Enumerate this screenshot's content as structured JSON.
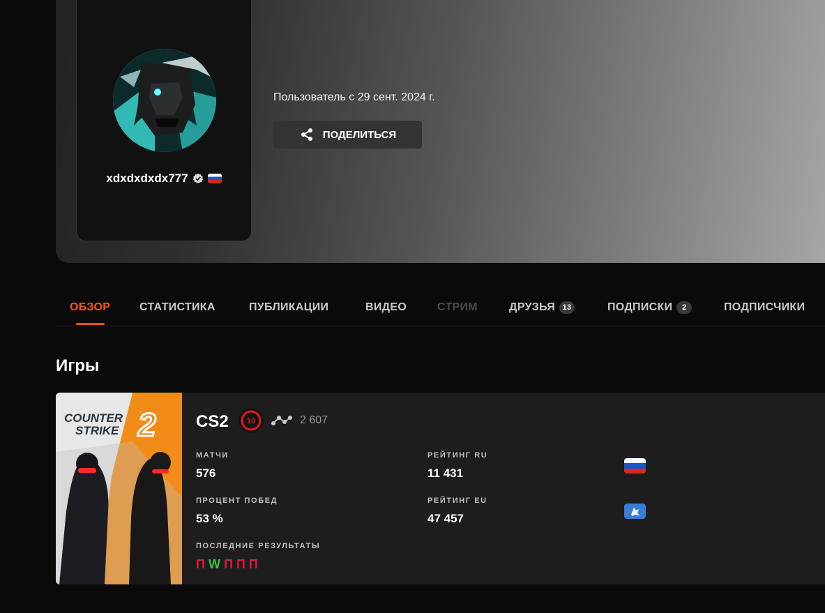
{
  "profile": {
    "username": "xdxdxdxdx777",
    "member_since": "Пользователь с 29 сент. 2024 г.",
    "share_label": "ПОДЕЛИТЬСЯ"
  },
  "tabs": [
    {
      "label": "ОБЗОР",
      "state": "active"
    },
    {
      "label": "СТАТИСТИКА"
    },
    {
      "label": "ПУБЛИКАЦИИ"
    },
    {
      "label": "ВИДЕО"
    },
    {
      "label": "СТРИМ",
      "state": "disabled"
    },
    {
      "label": "ДРУЗЬЯ",
      "badge": "13"
    },
    {
      "label": "ПОДПИСКИ",
      "badge": "2"
    },
    {
      "label": "ПОДПИСЧИКИ"
    }
  ],
  "games_title": "Игры",
  "game": {
    "name": "CS2",
    "cover_line1": "COUNTER",
    "cover_line2": "STRIKE",
    "cover_num": "2",
    "level": "10",
    "elo": "2 607",
    "matches_label": "МАТЧИ",
    "matches": "576",
    "winrate_label": "ПРОЦЕНТ ПОБЕД",
    "winrate": "53 %",
    "recent_label": "ПОСЛЕДНИЕ РЕЗУЛЬТАТЫ",
    "recent": [
      "П",
      "W",
      "П",
      "П",
      "П"
    ],
    "rating_ru_label": "РЕЙТИНГ RU",
    "rating_ru": "11 431",
    "rating_eu_label": "РЕЙТИНГ EU",
    "rating_eu": "47 457"
  },
  "colors": {
    "accent": "#ff5500",
    "win": "#3cc444",
    "loss": "#e1173a",
    "level": "#e01a1a"
  },
  "icons": [
    "verified-icon",
    "russia-flag-icon",
    "share-icon",
    "elo-graph-icon",
    "europe-region-icon"
  ]
}
